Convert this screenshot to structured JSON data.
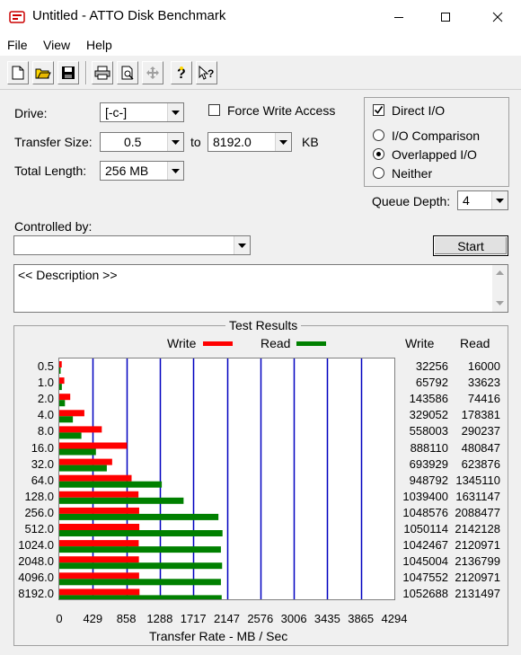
{
  "window": {
    "title": "Untitled - ATTO Disk Benchmark",
    "controls": [
      "minimize",
      "maximize",
      "close"
    ]
  },
  "menu": {
    "items": [
      {
        "label": "File"
      },
      {
        "label": "View"
      },
      {
        "label": "Help"
      }
    ]
  },
  "toolbar": {
    "buttons": [
      "new-icon",
      "open-icon",
      "save-icon",
      "print-icon",
      "print-preview-icon",
      "move-icon",
      "help-icon",
      "context-help-icon"
    ]
  },
  "form": {
    "drive": {
      "label": "Drive:",
      "value": "[-c-]"
    },
    "force_write": {
      "label": "Force Write Access",
      "checked": false
    },
    "transfer_size": {
      "label": "Transfer Size:",
      "from": "0.5",
      "to_label": "to",
      "to": "8192.0",
      "unit": "KB"
    },
    "total_length": {
      "label": "Total Length:",
      "value": "256 MB"
    },
    "direct_io": {
      "label": "Direct I/O",
      "checked": true
    },
    "io_mode": {
      "options": [
        {
          "label": "I/O Comparison",
          "selected": false
        },
        {
          "label": "Overlapped I/O",
          "selected": true
        },
        {
          "label": "Neither",
          "selected": false
        }
      ]
    },
    "queue_depth": {
      "label": "Queue Depth:",
      "value": "4"
    },
    "controlled_by": {
      "label": "Controlled by:",
      "value": ""
    },
    "start_label": "Start",
    "description": "<< Description >>"
  },
  "results": {
    "title": "Test Results",
    "legend": {
      "write": "Write",
      "read": "Read"
    },
    "col_headers": {
      "write": "Write",
      "read": "Read"
    },
    "xlabel": "Transfer Rate - MB / Sec",
    "colors": {
      "write": "#ff0000",
      "read": "#008000",
      "grid": "#0000c0"
    }
  },
  "chart_data": {
    "type": "bar",
    "orientation": "horizontal",
    "title": "Test Results",
    "xlabel": "Transfer Rate - MB / Sec",
    "xlim": [
      0,
      4294
    ],
    "xticks": [
      "0",
      "429",
      "858",
      "1288",
      "1717",
      "2147",
      "2576",
      "3006",
      "3435",
      "3865",
      "4294"
    ],
    "categories": [
      "0.5",
      "1.0",
      "2.0",
      "4.0",
      "8.0",
      "16.0",
      "32.0",
      "64.0",
      "128.0",
      "256.0",
      "512.0",
      "1024.0",
      "2048.0",
      "4096.0",
      "8192.0"
    ],
    "series": [
      {
        "name": "Write",
        "color": "#ff0000",
        "values": [
          32256,
          65792,
          143586,
          329052,
          558003,
          888110,
          693929,
          948792,
          1039400,
          1048576,
          1050114,
          1042467,
          1045004,
          1047552,
          1052688
        ]
      },
      {
        "name": "Read",
        "color": "#008000",
        "values": [
          16000,
          33623,
          74416,
          178381,
          290237,
          480847,
          623876,
          1345110,
          1631147,
          2088477,
          2142128,
          2120971,
          2136799,
          2120971,
          2131497
        ]
      }
    ],
    "grid": true,
    "legend_position": "top"
  }
}
